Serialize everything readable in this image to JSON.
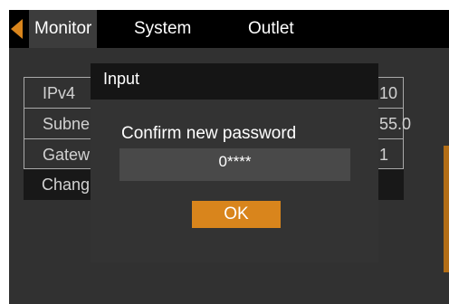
{
  "header": {
    "tabs": [
      {
        "label": "Monitor"
      },
      {
        "label": "System"
      },
      {
        "label": "Outlet"
      }
    ]
  },
  "network_table": {
    "rows": [
      {
        "label": "IPv4",
        "value": "10"
      },
      {
        "label": "Subne",
        "value": "55.0"
      },
      {
        "label": "Gatew",
        "value": "1"
      },
      {
        "label": "Chang",
        "value": ""
      }
    ]
  },
  "dialog": {
    "title": "Input",
    "prompt": "Confirm new password",
    "password_value": "0****",
    "ok_label": "OK"
  },
  "colors": {
    "accent": "#d9851c",
    "topbar": "#000000",
    "panel": "#3c3c3c",
    "dialog_header": "#151515"
  },
  "icons": {
    "back": "back-arrow-icon"
  }
}
